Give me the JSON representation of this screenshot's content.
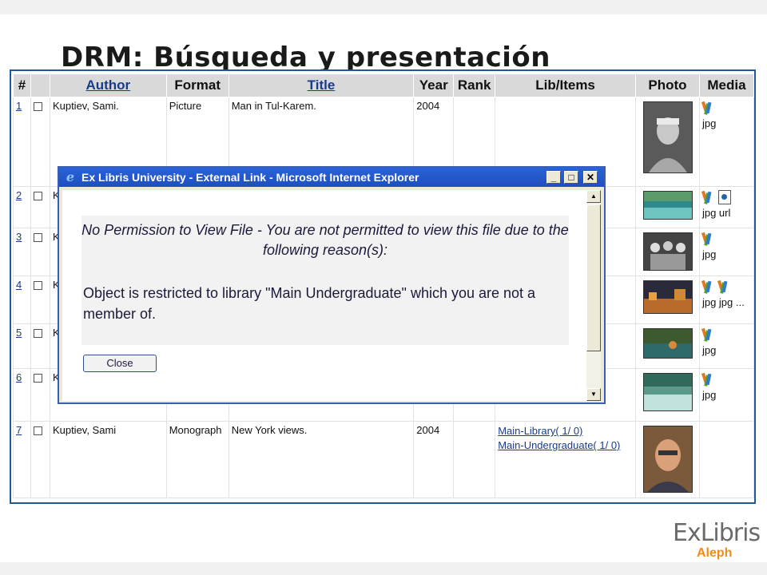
{
  "slide": {
    "title": "DRM: Búsqueda y presentación"
  },
  "table": {
    "headers": [
      "#",
      "Author",
      "Format",
      "Title",
      "Year",
      "Rank",
      "Lib/Items",
      "Photo",
      "Media"
    ],
    "rows": [
      {
        "num": "1",
        "author": "Kuptiev, Sami.",
        "format": "Picture",
        "title": "Man in Tul-Karem.",
        "year": "2004",
        "rank": "",
        "lib": [],
        "media": "jpg"
      },
      {
        "num": "2",
        "author": "K",
        "format": "",
        "title": "",
        "year": "",
        "rank": "",
        "lib": [],
        "media": "jpg url"
      },
      {
        "num": "3",
        "author": "K",
        "format": "",
        "title": "",
        "year": "",
        "rank": "",
        "lib": [],
        "media": "jpg"
      },
      {
        "num": "4",
        "author": "K",
        "format": "",
        "title": "",
        "year": "",
        "rank": "",
        "lib": [],
        "media": "jpg jpg ..."
      },
      {
        "num": "5",
        "author": "K",
        "format": "",
        "title": "",
        "year": "",
        "rank": "",
        "lib": [],
        "media": "jpg"
      },
      {
        "num": "6",
        "author": "K",
        "format": "",
        "title": "",
        "year": "",
        "rank": "",
        "lib": [],
        "media": "jpg"
      },
      {
        "num": "7",
        "author": "Kuptiev, Sami",
        "format": "Monograph",
        "title": "New York views.",
        "year": "2004",
        "rank": "",
        "lib": [
          "Main-Library( 1/ 0)",
          "Main-Undergraduate( 1/ 0)"
        ],
        "media": ""
      }
    ]
  },
  "dialog": {
    "title": "Ex Libris University - External Link - Microsoft Internet Explorer",
    "heading": "No Permission to View File - You are not permitted to view this file due to the following reason(s):",
    "message": "Object is restricted to library \"Main Undergraduate\" which you are not a member of.",
    "close_label": "Close",
    "min_glyph": "_",
    "max_glyph": "□",
    "close_glyph": "✕"
  },
  "logo": {
    "brand": "ExLibris",
    "product": "Aleph"
  },
  "colors": {
    "frame_border": "#1f5a96",
    "header_bg": "#d9d9d9",
    "link": "#1a3b8a",
    "titlebar": "#2a62d8",
    "aleph": "#f28c14"
  }
}
